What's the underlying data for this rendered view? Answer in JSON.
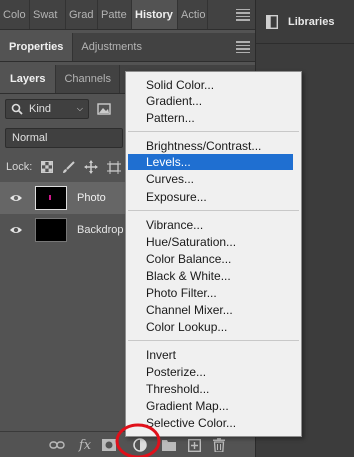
{
  "top_panel": {
    "tabs": [
      "Colo",
      "Swat",
      "Grad",
      "Patte",
      "History",
      "Actio"
    ]
  },
  "libraries_panel": {
    "title": "Libraries"
  },
  "properties_panel": {
    "tabs": [
      "Properties",
      "Adjustments"
    ]
  },
  "layers_panel": {
    "tabs": [
      "Layers",
      "Channels",
      "P"
    ],
    "filter_kind": "Kind",
    "blend_mode": "Normal",
    "lock_label": "Lock:",
    "layers": [
      {
        "name": "Photo",
        "visible": true,
        "selected": true
      },
      {
        "name": "Backdrop",
        "visible": true,
        "selected": false
      }
    ]
  },
  "adjustment_menu": {
    "groups": [
      [
        "Solid Color...",
        "Gradient...",
        "Pattern..."
      ],
      [
        "Brightness/Contrast...",
        "Levels...",
        "Curves...",
        "Exposure..."
      ],
      [
        "Vibrance...",
        "Hue/Saturation...",
        "Color Balance...",
        "Black & White...",
        "Photo Filter...",
        "Channel Mixer...",
        "Color Lookup..."
      ],
      [
        "Invert",
        "Posterize...",
        "Threshold...",
        "Gradient Map...",
        "Selective Color..."
      ]
    ],
    "highlighted": "Levels..."
  },
  "footer_icons": [
    "link-icon",
    "fx-icon",
    "mask-icon",
    "adjustment-icon",
    "group-icon",
    "new-layer-icon",
    "trash-icon"
  ],
  "colors": {
    "highlight": "#1f6fd1",
    "annotation_circle": "#e0101a"
  }
}
